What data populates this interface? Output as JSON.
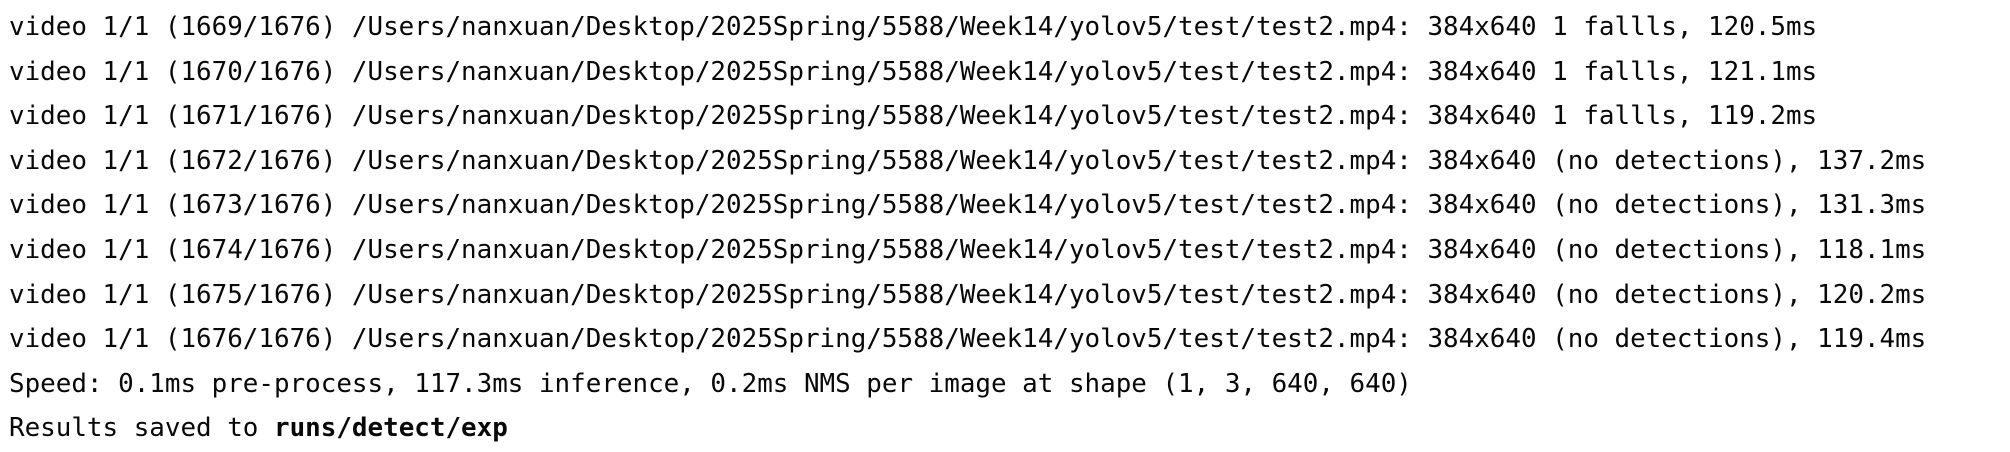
{
  "terminal": {
    "lines": [
      "video 1/1 (1669/1676) /Users/nanxuan/Desktop/2025Spring/5588/Week14/yolov5/test/test2.mp4: 384x640 1 fallls, 120.5ms",
      "video 1/1 (1670/1676) /Users/nanxuan/Desktop/2025Spring/5588/Week14/yolov5/test/test2.mp4: 384x640 1 fallls, 121.1ms",
      "video 1/1 (1671/1676) /Users/nanxuan/Desktop/2025Spring/5588/Week14/yolov5/test/test2.mp4: 384x640 1 fallls, 119.2ms",
      "video 1/1 (1672/1676) /Users/nanxuan/Desktop/2025Spring/5588/Week14/yolov5/test/test2.mp4: 384x640 (no detections), 137.2ms",
      "video 1/1 (1673/1676) /Users/nanxuan/Desktop/2025Spring/5588/Week14/yolov5/test/test2.mp4: 384x640 (no detections), 131.3ms",
      "video 1/1 (1674/1676) /Users/nanxuan/Desktop/2025Spring/5588/Week14/yolov5/test/test2.mp4: 384x640 (no detections), 118.1ms",
      "video 1/1 (1675/1676) /Users/nanxuan/Desktop/2025Spring/5588/Week14/yolov5/test/test2.mp4: 384x640 (no detections), 120.2ms",
      "video 1/1 (1676/1676) /Users/nanxuan/Desktop/2025Spring/5588/Week14/yolov5/test/test2.mp4: 384x640 (no detections), 119.4ms"
    ],
    "speed_line": "Speed: 0.1ms pre-process, 117.3ms inference, 0.2ms NMS per image at shape (1, 3, 640, 640)",
    "results_prefix": "Results saved to ",
    "results_path": "runs/detect/exp"
  },
  "colors": {
    "background": "#ffffff",
    "text": "#080808"
  }
}
